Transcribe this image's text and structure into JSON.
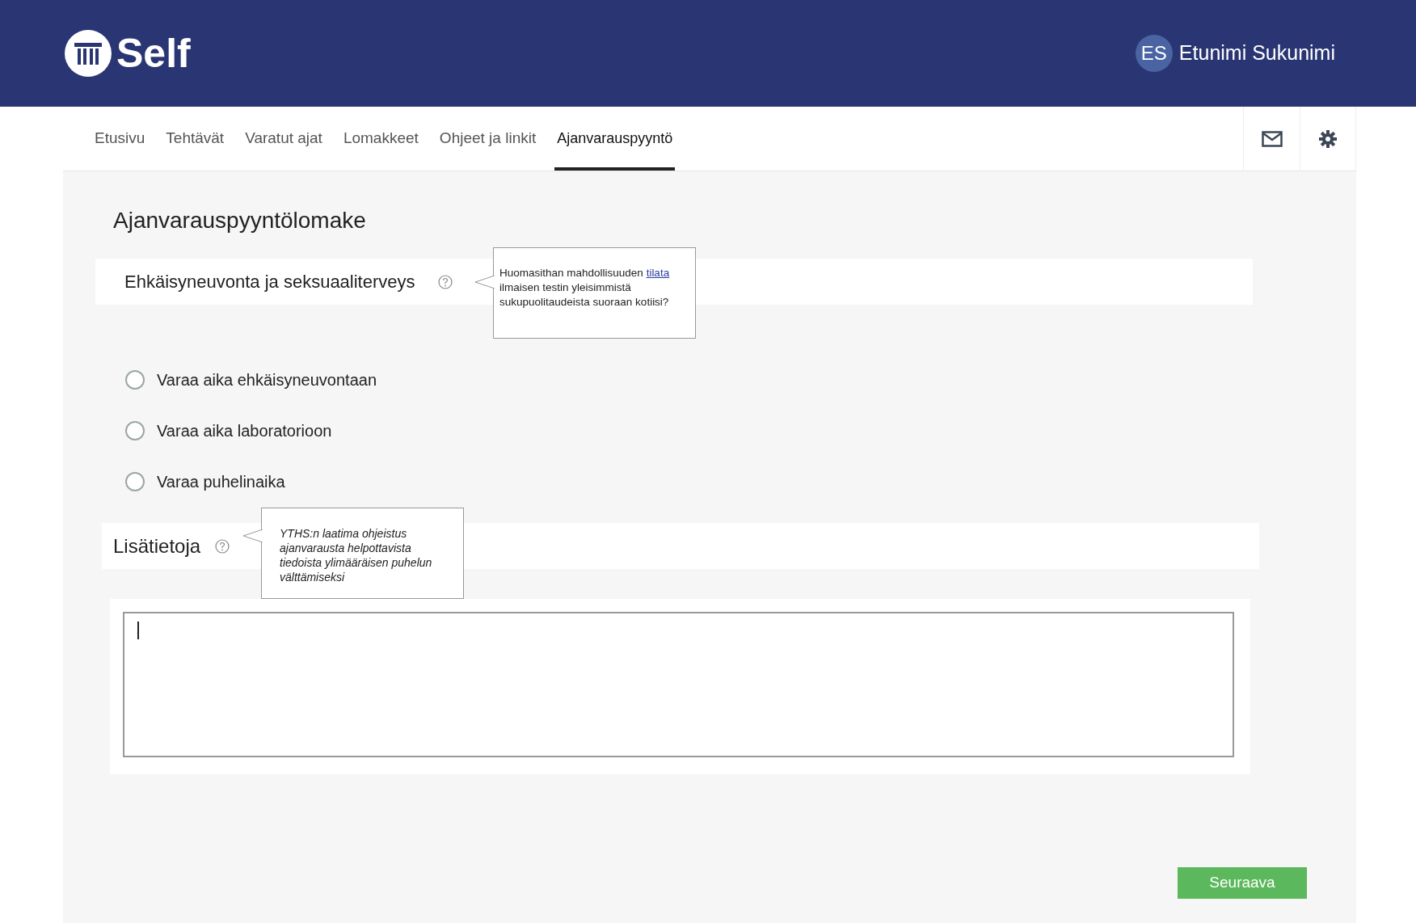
{
  "header": {
    "logo_text": "Self",
    "user": {
      "initials": "ES",
      "name": "Etunimi Sukunimi"
    }
  },
  "nav": {
    "tabs": [
      {
        "label": "Etusivu",
        "selected": false
      },
      {
        "label": "Tehtävät",
        "selected": false
      },
      {
        "label": "Varatut ajat",
        "selected": false
      },
      {
        "label": "Lomakkeet",
        "selected": false
      },
      {
        "label": "Ohjeet ja linkit",
        "selected": false
      },
      {
        "label": "Ajanvarauspyyntö",
        "selected": true
      }
    ]
  },
  "page_title": "Ajanvarauspyyntölomake",
  "section": {
    "heading": "Ehkäisyneuvonta ja seksuaaliterveys",
    "tooltip": {
      "text_before": "Huomasithan mahdollisuuden",
      "link": "tilata",
      "text_after": "ilmaisen testin yleisimmistä sukupuolitaudeista suoraan kotiisi?"
    }
  },
  "options": [
    {
      "label": "Varaa aika ehkäisyneuvontaan",
      "selected": false
    },
    {
      "label": "Varaa aika laboratorioon",
      "selected": false
    },
    {
      "label": "Varaa puhelinaika",
      "selected": false
    }
  ],
  "details": {
    "heading": "Lisätietoja",
    "tooltip": "YTHS:n laatima ohjeistus ajanvarausta helpottavista tiedoista ylimääräisen puhelun välttämiseksi"
  },
  "next_button": "Seuraava"
}
